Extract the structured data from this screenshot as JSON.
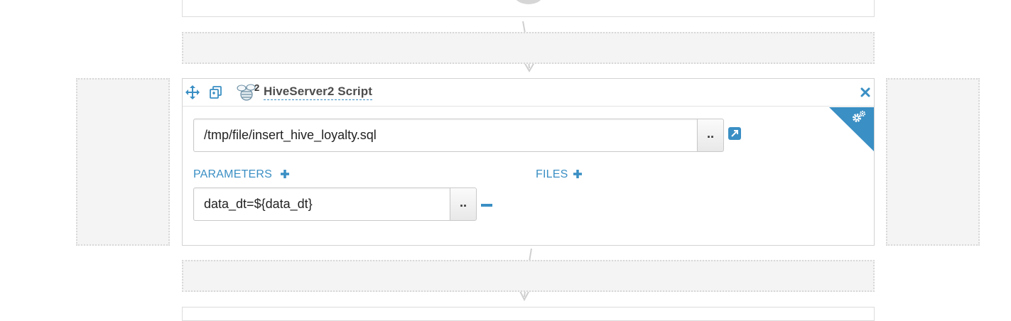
{
  "action": {
    "title": "HiveServer2 Script",
    "badge_count": "2",
    "script_path": "/tmp/file/insert_hive_loyalty.sql",
    "browse_label": "..",
    "parameters_label": "PARAMETERS",
    "files_label": "FILES",
    "parameters": [
      {
        "value": "data_dt=${data_dt}"
      }
    ]
  },
  "icons": {
    "move": "move-icon",
    "copy": "copy-icon",
    "hive": "hive-bee-icon",
    "close": "close-icon",
    "settings": "gears-icon",
    "open": "external-link-icon",
    "add": "plus-icon",
    "remove": "minus-icon"
  },
  "colors": {
    "accent": "#3a8fc4",
    "drop_zone": "#f4f4f4",
    "border": "#d3d3d3"
  }
}
